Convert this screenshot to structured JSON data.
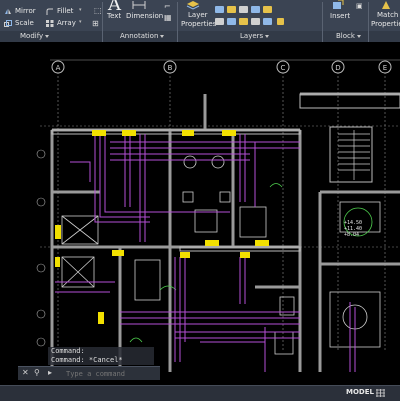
{
  "ribbon": {
    "modify": {
      "mirror_label": "Mirror",
      "fillet_label": "Fillet",
      "scale_label": "Scale",
      "array_label": "Array",
      "panel_title": "Modify"
    },
    "annotation": {
      "text_label": "Text",
      "dimension_label": "Dimension",
      "panel_title": "Annotation"
    },
    "layers": {
      "layer_properties_line1": "Layer",
      "layer_properties_line2": "Properties",
      "panel_title": "Layers"
    },
    "block": {
      "insert_label": "Insert",
      "panel_title": "Block"
    },
    "properties": {
      "match_line1": "Match",
      "match_line2": "Properties"
    }
  },
  "drawing": {
    "grid_bubbles": [
      "A",
      "B",
      "C",
      "D",
      "E"
    ],
    "annotations": [
      "+14.50",
      "+11.40",
      "+8.04"
    ],
    "colors": {
      "wall": "#9a9a9a",
      "wiring": "#b54fd6",
      "fixture": "#f2e000",
      "furniture": "#cfcfcf",
      "green_text": "#4fd14f"
    }
  },
  "command": {
    "history": [
      "Command:",
      "Command: *Cancel*"
    ],
    "placeholder": "Type a command"
  },
  "status": {
    "model_label": "MODEL"
  }
}
